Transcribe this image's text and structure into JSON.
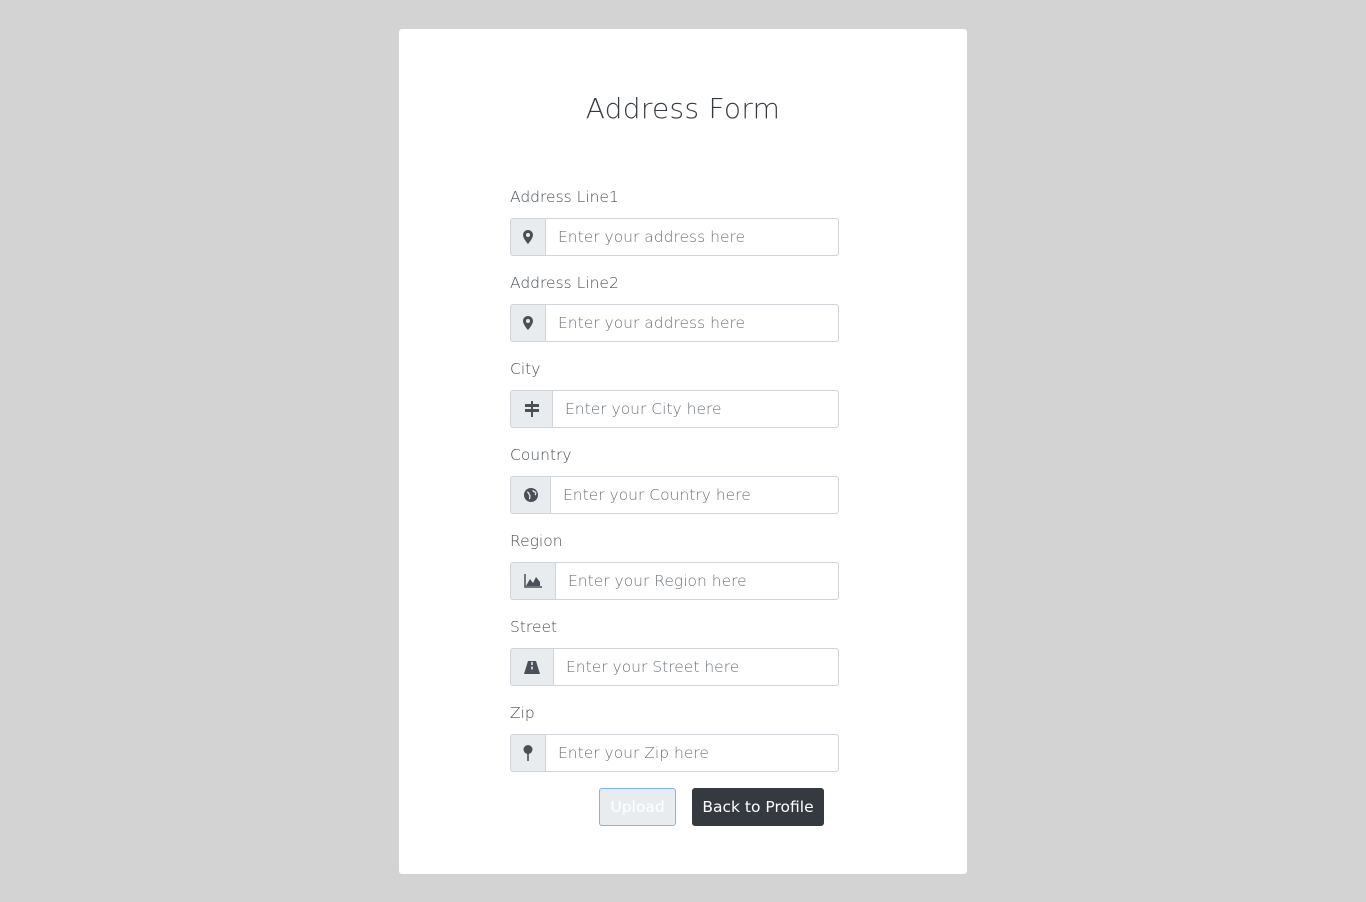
{
  "form": {
    "title": "Address Form",
    "fields": [
      {
        "label": "Address Line1",
        "placeholder": "Enter your address here",
        "value": "",
        "icon": "map-marker-icon"
      },
      {
        "label": "Address Line2",
        "placeholder": "Enter your address here",
        "value": "",
        "icon": "map-marker-icon"
      },
      {
        "label": "City",
        "placeholder": "Enter your City here",
        "value": "",
        "icon": "signpost-icon"
      },
      {
        "label": "Country",
        "placeholder": "Enter your Country here",
        "value": "",
        "icon": "globe-icon"
      },
      {
        "label": "Region",
        "placeholder": "Enter your Region here",
        "value": "",
        "icon": "area-chart-icon"
      },
      {
        "label": "Street",
        "placeholder": "Enter your Street here",
        "value": "",
        "icon": "road-icon"
      },
      {
        "label": "Zip",
        "placeholder": "Enter your Zip here",
        "value": "",
        "icon": "map-pin-icon"
      }
    ],
    "upload_label": "Upload",
    "back_label": "Back to Profile"
  },
  "colors": {
    "background": "#d3d3d3",
    "card": "#ffffff",
    "addon": "#e9ecef",
    "border": "#ced4da",
    "back_button": "#343a40",
    "upload_border": "#80b3f0"
  }
}
